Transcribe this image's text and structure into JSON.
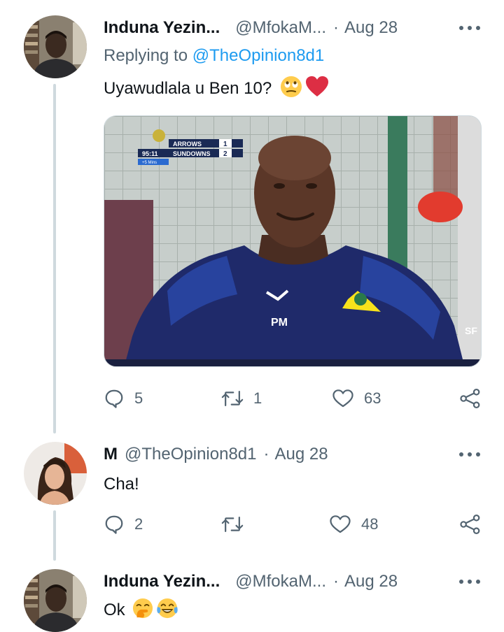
{
  "tweets": [
    {
      "name": "Induna Yezin...",
      "handle": "@MfokaM...",
      "dot": "·",
      "date": "Aug 28",
      "replying_prefix": "Replying to",
      "replying_to": "@TheOpinion8d1",
      "text": "Uyawudlala u Ben 10?",
      "emojis": [
        "eye-roll-emoji",
        "red-heart-emoji"
      ],
      "media": {
        "scoreboard": {
          "time": "95:11",
          "added": "+5 Mins",
          "team1": "ARROWS",
          "score1": "1",
          "team2": "SUNDOWNS",
          "score2": "2"
        },
        "shirt_initials": "PM",
        "corner_logo": "SF"
      },
      "actions": {
        "replies": "5",
        "retweets": "1",
        "likes": "63"
      }
    },
    {
      "name": "M",
      "handle": "@TheOpinion8d1",
      "dot": "·",
      "date": "Aug 28",
      "text": "Cha!",
      "actions": {
        "replies": "2",
        "retweets": "",
        "likes": "48"
      }
    },
    {
      "name": "Induna Yezin...",
      "handle": "@MfokaM...",
      "dot": "·",
      "date": "Aug 28",
      "text": "Ok",
      "emojis": [
        "face-with-hand-over-mouth-emoji",
        "tears-of-joy-emoji"
      ]
    }
  ],
  "colors": {
    "text": "#0f1419",
    "secondary": "#536471",
    "accent": "#1d9bf0",
    "like_red": "#e0245e",
    "thread_line": "#cfd9de"
  }
}
